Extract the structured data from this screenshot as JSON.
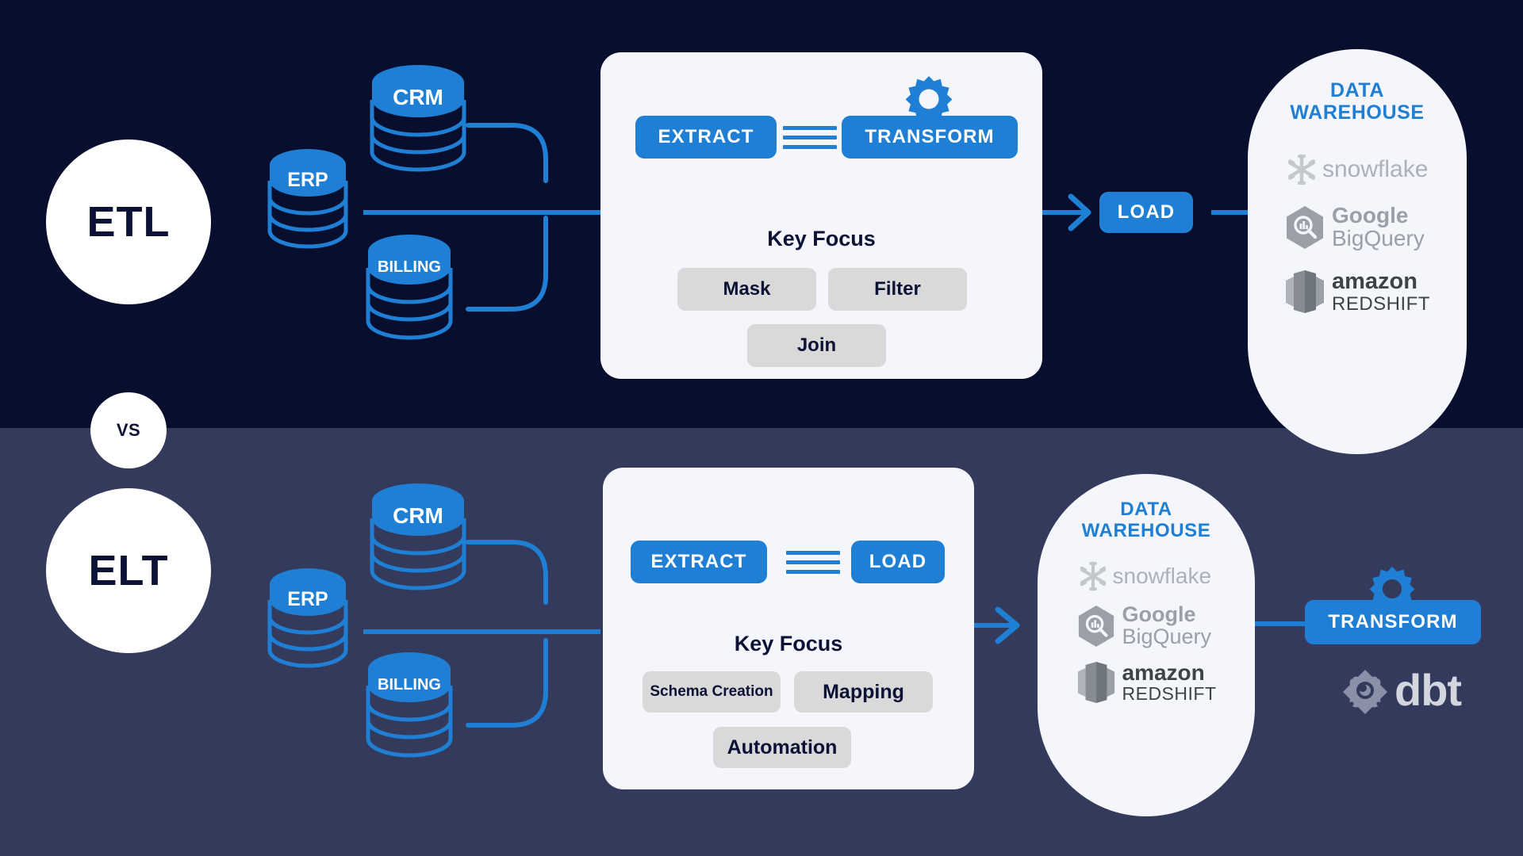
{
  "theme": {
    "bg_top": "#070e2e",
    "bg_bottom": "#333a5c",
    "accent_blue": "#1f7fd4",
    "panel_bg": "#f4f6fb",
    "chip_bg": "#d9d9d9",
    "text_dark": "#0b1235",
    "white": "#ffffff"
  },
  "divider": {
    "vs_label": "VS"
  },
  "etl": {
    "title": "ETL",
    "sources": [
      {
        "name": "CRM",
        "label": "CRM"
      },
      {
        "name": "ERP",
        "label": "ERP"
      },
      {
        "name": "BILLING",
        "label": "BILLING"
      }
    ],
    "stages": {
      "extract": "EXTRACT",
      "transform": "TRANSFORM",
      "load": "LOAD"
    },
    "key_focus": {
      "title": "Key Focus",
      "items": [
        "Mask",
        "Filter",
        "Join"
      ]
    },
    "warehouse": {
      "title_line1": "DATA",
      "title_line2": "WAREHOUSE",
      "logos": [
        {
          "name": "snowflake",
          "word": "snowflake"
        },
        {
          "name": "google-bigquery",
          "word_top": "Google",
          "word_bottom": "BigQuery"
        },
        {
          "name": "amazon-redshift",
          "word_top": "amazon",
          "word_bottom": "REDSHIFT"
        }
      ]
    }
  },
  "elt": {
    "title": "ELT",
    "sources": [
      {
        "name": "CRM",
        "label": "CRM"
      },
      {
        "name": "ERP",
        "label": "ERP"
      },
      {
        "name": "BILLING",
        "label": "BILLING"
      }
    ],
    "stages": {
      "extract": "EXTRACT",
      "load": "LOAD",
      "transform": "TRANSFORM"
    },
    "key_focus": {
      "title": "Key Focus",
      "items": [
        "Schema Creation",
        "Mapping",
        "Automation"
      ]
    },
    "warehouse": {
      "title_line1": "DATA",
      "title_line2": "WAREHOUSE",
      "logos": [
        {
          "name": "snowflake",
          "word": "snowflake"
        },
        {
          "name": "google-bigquery",
          "word_top": "Google",
          "word_bottom": "BigQuery"
        },
        {
          "name": "amazon-redshift",
          "word_top": "amazon",
          "word_bottom": "REDSHIFT"
        }
      ]
    },
    "tool": {
      "name": "dbt",
      "word": "dbt"
    }
  }
}
